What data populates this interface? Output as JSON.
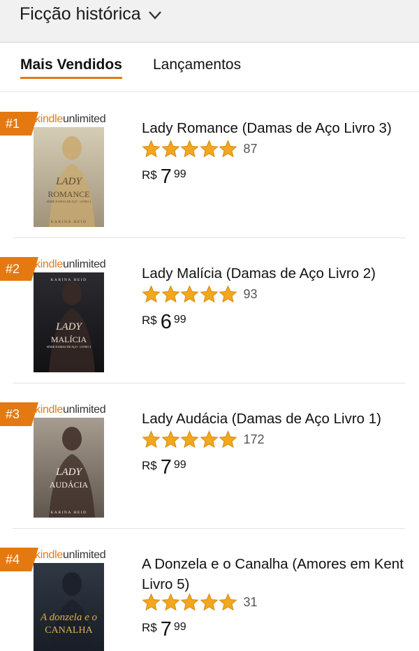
{
  "header": {
    "category": "Ficção histórica"
  },
  "tabs": [
    {
      "label": "Mais Vendidos",
      "active": true
    },
    {
      "label": "Lançamentos",
      "active": false
    }
  ],
  "badge_brand": {
    "kindle": "kindle",
    "unlimited": "unlimited"
  },
  "books": [
    {
      "rank": "#1",
      "title": "Lady Romance (Damas de Aço Livro 3)",
      "rating": 5,
      "reviews": "87",
      "currency": "R$",
      "price_int": "7",
      "price_dec": "99",
      "cover": {
        "author": "KARINA HEID",
        "title_line1": "LADY",
        "title_line2": "ROMANCE",
        "subtitle": "SÉRIE DAMAS DE AÇO · LIVRO 3"
      }
    },
    {
      "rank": "#2",
      "title": "Lady Malícia (Damas de Aço Livro 2)",
      "rating": 5,
      "reviews": "93",
      "currency": "R$",
      "price_int": "6",
      "price_dec": "99",
      "cover": {
        "author": "KARINA HEID",
        "title_line1": "LADY",
        "title_line2": "MALÍCIA",
        "subtitle": "SÉRIE DAMAS DE AÇO · LIVRO 2"
      }
    },
    {
      "rank": "#3",
      "title": "Lady Audácia (Damas de Aço Livro 1)",
      "rating": 5,
      "reviews": "172",
      "currency": "R$",
      "price_int": "7",
      "price_dec": "99",
      "cover": {
        "author": "KARINA HEID",
        "title_line1": "LADY",
        "title_line2": "AUDÁCIA",
        "subtitle": ""
      }
    },
    {
      "rank": "#4",
      "title": "A Donzela e o Canalha (Amores em Kent Livro 5)",
      "rating": 5,
      "reviews": "31",
      "currency": "R$",
      "price_int": "7",
      "price_dec": "99",
      "cover": {
        "author": "",
        "title_line1": "A donzela e o",
        "title_line2": "CANALHA",
        "subtitle": ""
      }
    }
  ],
  "colors": {
    "accent": "#e47911",
    "star": "#f2a71e",
    "star_edge": "#d48a0c"
  }
}
